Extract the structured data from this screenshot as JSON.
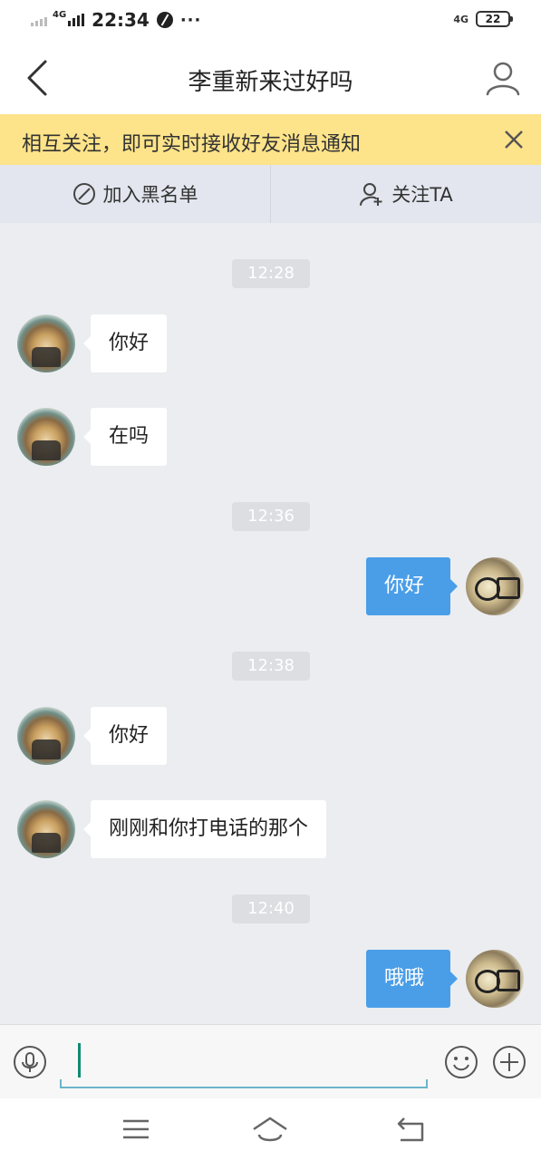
{
  "status_bar": {
    "network_left": "4G",
    "time": "22:34",
    "more": "···",
    "network_right": "4G",
    "battery": "22"
  },
  "header": {
    "title": "李重新来过好吗",
    "back_icon": "chevron-left-icon",
    "profile_icon": "person-icon"
  },
  "notice": {
    "text": "相互关注，即可实时接收好友消息通知",
    "close_icon": "close-icon"
  },
  "actions": {
    "blacklist": {
      "icon": "ban-icon",
      "label": "加入黑名单"
    },
    "follow": {
      "icon": "add-user-icon",
      "label": "关注TA"
    }
  },
  "chat": {
    "timestamps": [
      "12:28",
      "12:36",
      "12:38",
      "12:40"
    ],
    "messages": [
      {
        "side": "incoming",
        "text": "你好"
      },
      {
        "side": "incoming",
        "text": "在吗"
      },
      {
        "side": "outgoing",
        "text": "你好"
      },
      {
        "side": "incoming",
        "text": "你好"
      },
      {
        "side": "incoming",
        "text": "刚刚和你打电话的那个"
      },
      {
        "side": "outgoing",
        "text": "哦哦"
      }
    ]
  },
  "input_bar": {
    "value": "",
    "voice_icon": "microphone-icon",
    "emoji_icon": "smiley-icon",
    "more_icon": "plus-circle-icon"
  },
  "system_nav": {
    "menu_icon": "menu-icon",
    "home_icon": "home-icon",
    "back_icon": "back-icon"
  },
  "colors": {
    "notice_bg": "#fde38a",
    "outgoing_bubble": "#4a9ee8",
    "chat_bg": "#ebedf0",
    "input_underline": "#6bb5c9"
  }
}
